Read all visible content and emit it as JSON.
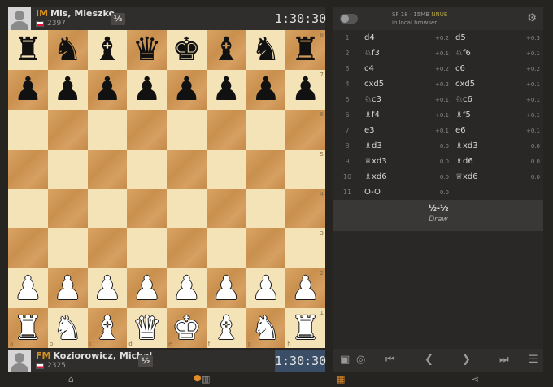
{
  "top_player": {
    "title": "IM",
    "name": "Mis, Mieszko",
    "rating": "2397",
    "score": "½",
    "clock": "1:30:30"
  },
  "bottom_player": {
    "title": "FM",
    "name": "Koziorowicz, Michal",
    "rating": "2325",
    "score": "½",
    "clock": "1:30:30"
  },
  "board": {
    "ranks": [
      "8",
      "7",
      "6",
      "5",
      "4",
      "3",
      "2",
      "1"
    ],
    "files": [
      "a",
      "b",
      "c",
      "d",
      "e",
      "f",
      "g",
      "h"
    ],
    "rows": [
      [
        "♜b",
        "♞b",
        "♝b",
        "♛b",
        "♚b",
        "♝b",
        "♞b",
        "♜b"
      ],
      [
        "♟b",
        "♟b",
        "♟b",
        "♟b",
        "♟b",
        "♟b",
        "♟b",
        "♟b"
      ],
      [
        "",
        "",
        "",
        "",
        "",
        "",
        "",
        ""
      ],
      [
        "",
        "",
        "",
        "",
        "",
        "",
        "",
        ""
      ],
      [
        "",
        "",
        "",
        "",
        "",
        "",
        "",
        ""
      ],
      [
        "",
        "",
        "",
        "",
        "",
        "",
        "",
        ""
      ],
      [
        "♟w",
        "♟w",
        "♟w",
        "♟w",
        "♟w",
        "♟w",
        "♟w",
        "♟w"
      ],
      [
        "♜w",
        "♞w",
        "♝w",
        "♛w",
        "♚w",
        "♝w",
        "♞w",
        "♜w"
      ]
    ]
  },
  "engine": {
    "name": "SF 18 · 15MB",
    "tag": "NNUE",
    "location": "in local browser",
    "enabled": false
  },
  "moves": [
    {
      "n": "1",
      "w": "d4",
      "we": "+0.2",
      "b": "d5",
      "be": "+0.3"
    },
    {
      "n": "2",
      "w": "♘f3",
      "we": "+0.1",
      "b": "♘f6",
      "be": "+0.1"
    },
    {
      "n": "3",
      "w": "c4",
      "we": "+0.2",
      "b": "c6",
      "be": "+0.2"
    },
    {
      "n": "4",
      "w": "cxd5",
      "we": "+0.2",
      "b": "cxd5",
      "be": "+0.1"
    },
    {
      "n": "5",
      "w": "♘c3",
      "we": "+0.1",
      "b": "♘c6",
      "be": "+0.1"
    },
    {
      "n": "6",
      "w": "♗f4",
      "we": "+0.1",
      "b": "♗f5",
      "be": "+0.1"
    },
    {
      "n": "7",
      "w": "e3",
      "we": "+0.1",
      "b": "e6",
      "be": "+0.1"
    },
    {
      "n": "8",
      "w": "♗d3",
      "we": "0.0",
      "b": "♗xd3",
      "be": "0.0"
    },
    {
      "n": "9",
      "w": "♕xd3",
      "we": "0.0",
      "b": "♗d6",
      "be": "0.0"
    },
    {
      "n": "10",
      "w": "♗xd6",
      "we": "0.0",
      "b": "♕xd6",
      "be": "0.0"
    },
    {
      "n": "11",
      "w": "O-O",
      "we": "0.0",
      "b": "",
      "be": ""
    }
  ],
  "result": {
    "score": "½-½",
    "text": "Draw"
  },
  "icons": {
    "gear": "gear-icon",
    "book": "book-icon",
    "target": "target-icon",
    "first": "first-move-icon",
    "prev": "prev-move-icon",
    "next": "next-move-icon",
    "last": "last-move-icon",
    "menu": "menu-icon",
    "tag": "tag-icon",
    "chart": "chart-icon",
    "grid": "grid-icon",
    "share": "share-icon"
  }
}
